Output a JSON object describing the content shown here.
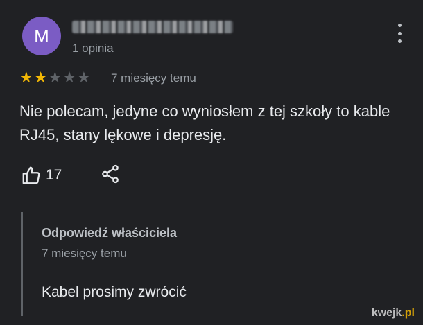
{
  "reviewer": {
    "avatar_letter": "M",
    "avatar_color": "#7b5cc4",
    "review_count_text": "1 opinia"
  },
  "review": {
    "rating": 2,
    "max_rating": 5,
    "star_color": "#f2b705",
    "time_text": "7 miesięcy temu",
    "text": "Nie polecam, jedyne co wyniosłem z tej szkoły to kable RJ45, stany lękowe i depresję.",
    "like_count": "17",
    "like_icon": "thumbs-up-icon",
    "share_icon": "share-icon",
    "menu_icon": "more-vert-icon"
  },
  "owner_reply": {
    "label": "Odpowiedź właściciela",
    "time_text": "7 miesięcy temu",
    "text": "Kabel prosimy zwrócić"
  },
  "watermark": {
    "text_main": "kwejk",
    "text_accent": ".pl"
  }
}
